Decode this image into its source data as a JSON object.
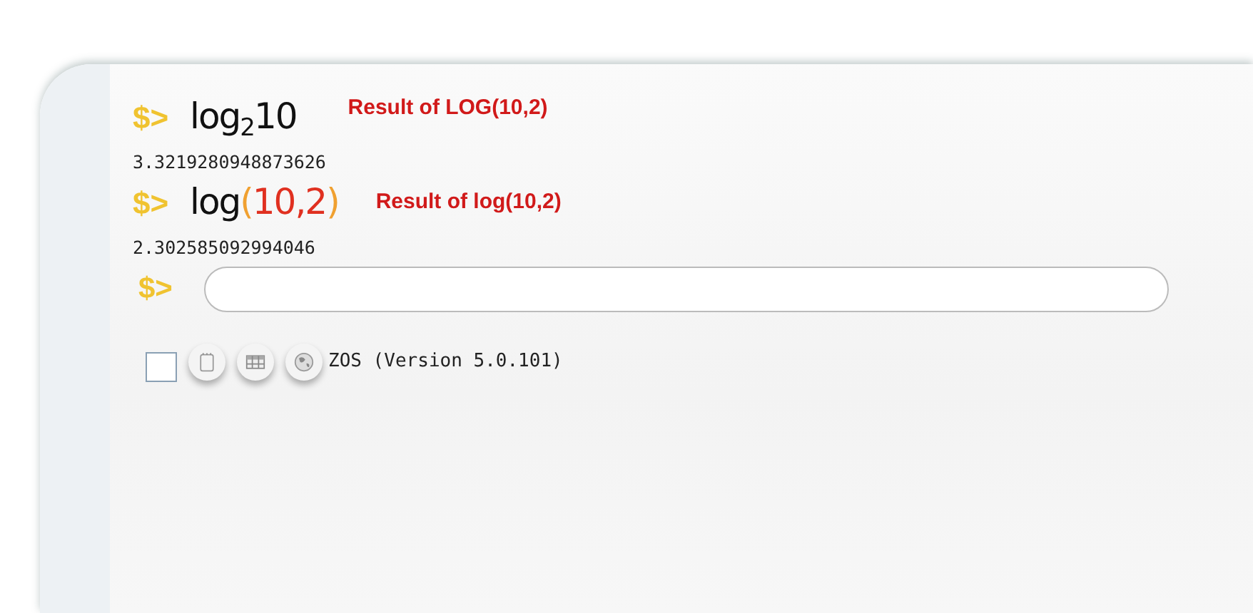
{
  "console": {
    "entries": [
      {
        "prompt": "$>",
        "expression": [
          {
            "kind": "plain",
            "text": "log"
          },
          {
            "kind": "sub",
            "text": "2"
          },
          {
            "kind": "plain",
            "text": "10"
          }
        ],
        "note": "Result of LOG(10,2)",
        "result": "3.3219280948873626"
      },
      {
        "prompt": "$>",
        "expression": [
          {
            "kind": "plain",
            "text": "log"
          },
          {
            "kind": "paren",
            "text": "("
          },
          {
            "kind": "arg",
            "text": "10,2"
          },
          {
            "kind": "paren",
            "text": ")"
          }
        ],
        "note": "Result of log(10,2)",
        "result": "2.302585092994046"
      }
    ],
    "input": {
      "prompt": "$>"
    },
    "toolbar": {
      "checkbox": {
        "checked": false
      },
      "buttons": [
        {
          "kind": "notepad"
        },
        {
          "kind": "table"
        },
        {
          "kind": "globe"
        }
      ],
      "version": "ZOS (Version 5.0.101)"
    }
  }
}
